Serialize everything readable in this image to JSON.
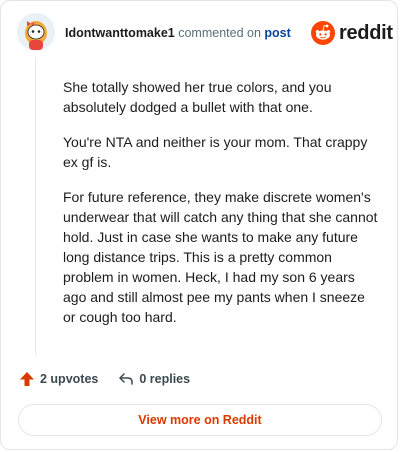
{
  "header": {
    "username": "Idontwanttomake1",
    "action_text": "commented on",
    "link_text": "post",
    "logo_text": "reddit"
  },
  "comment": {
    "paragraphs": [
      "She totally showed her true colors, and you absolutely dodged a bullet with that one.",
      "You're NTA and neither is your mom. That crappy ex gf is.",
      "For future reference, they make discrete women's underwear that will catch any thing that she cannot hold. Just in case she wants to make any future long distance trips. This is a pretty common problem in women. Heck, I had my son 6 years ago and still almost pee my pants when I sneeze or cough too hard."
    ]
  },
  "actions": {
    "upvotes_label": "2 upvotes",
    "replies_label": "0 replies",
    "upvote_icon": "upvote-arrow-icon",
    "reply_icon": "reply-arrow-icon"
  },
  "footer": {
    "view_more_label": "View more on Reddit"
  },
  "colors": {
    "brand_orange": "#ff4500",
    "link_blue": "#0a449b",
    "view_more_red": "#d93a00"
  }
}
